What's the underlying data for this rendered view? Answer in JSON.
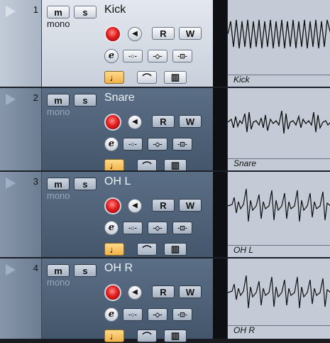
{
  "tracks": [
    {
      "number": "1",
      "name": "Kick",
      "channel": "mono",
      "lane_label": "Kick",
      "selected": true
    },
    {
      "number": "2",
      "name": "Snare",
      "channel": "mono",
      "lane_label": "Snare",
      "selected": false
    },
    {
      "number": "3",
      "name": "OH L",
      "channel": "mono",
      "lane_label": "OH L",
      "selected": false
    },
    {
      "number": "4",
      "name": "OH R",
      "channel": "mono",
      "lane_label": "OH R",
      "selected": false
    }
  ],
  "buttons": {
    "mute": "m",
    "solo": "s",
    "read": "R",
    "write": "W",
    "edit": "e"
  },
  "icons": {
    "expand": "triangle-expand-icon",
    "record": "record-icon",
    "monitor": "speaker-icon",
    "eq": "eq-icon",
    "inserts": "inserts-icon",
    "sends": "sends-icon",
    "time_base": "musical-note-icon",
    "lock": "lock-icon",
    "lanes": "lanes-icon"
  },
  "colors": {
    "record": "#e01e1e",
    "note_button": "#f0b24a",
    "selected_track": "#d6dce5",
    "unselected_track": "#4e6178"
  }
}
